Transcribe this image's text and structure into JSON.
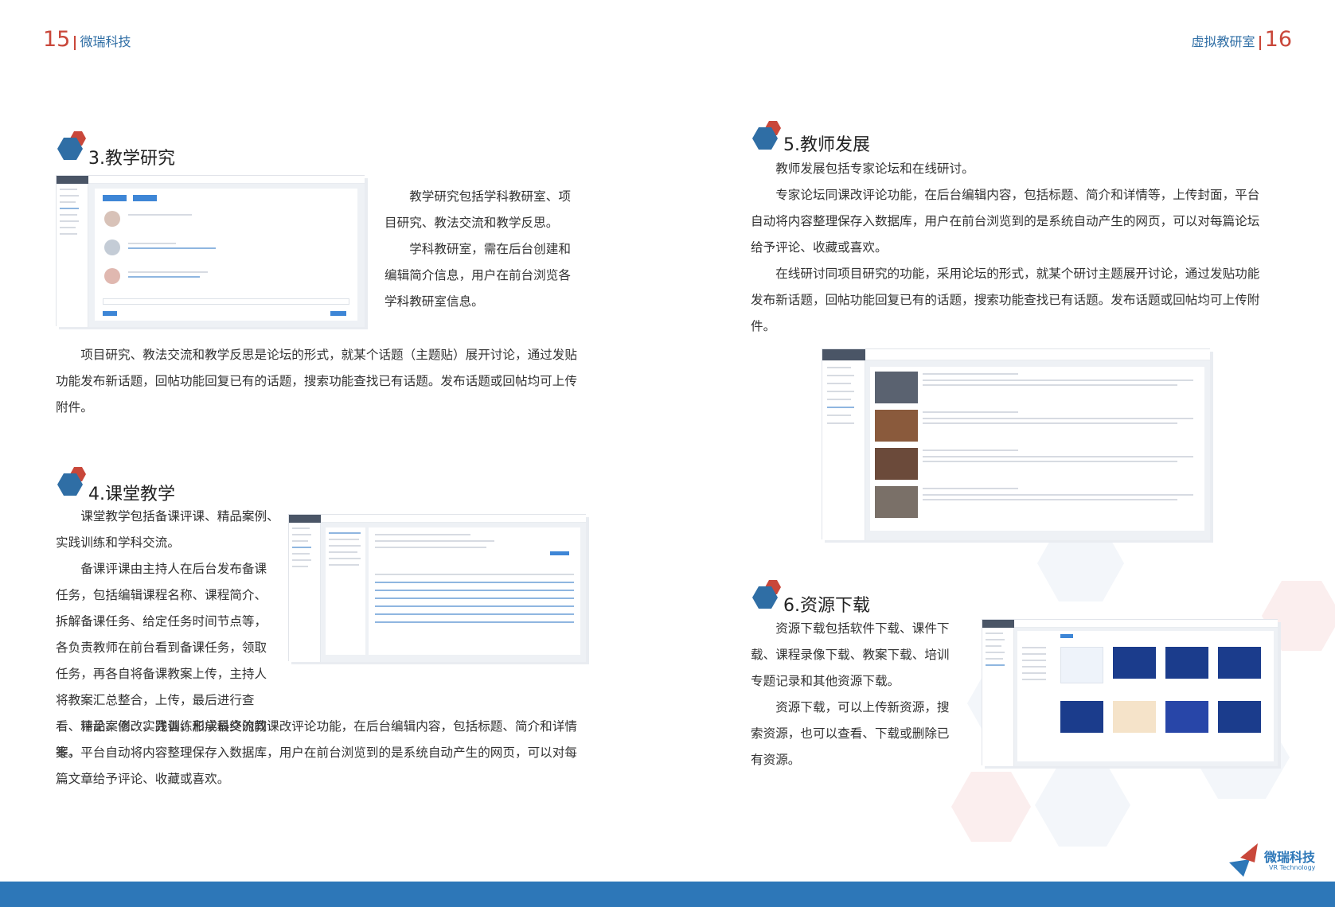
{
  "header": {
    "left_page_number": "15",
    "left_brand": "微瑞科技",
    "right_title": "虚拟教研室",
    "right_page_number": "16"
  },
  "section3": {
    "title": "3.教学研究",
    "para1": "教学研究包括学科教研室、项目研究、教法交流和教学反思。",
    "para2": "学科教研室，需在后台创建和编辑简介信息，用户在前台浏览各学科教研室信息。",
    "para3": "项目研究、教法交流和教学反思是论坛的形式，就某个话题（主题贴）展开讨论，通过发贴功能发布新话题，回帖功能回复已有的话题，搜索功能查找已有话题。发布话题或回帖均可上传附件。"
  },
  "section4": {
    "title": "4.课堂教学",
    "para1": "课堂教学包括备课评课、精品案例、实践训练和学科交流。",
    "para2": "备课评课由主持人在后台发布备课任务，包括编辑课程名称、课程简介、拆解备课任务、给定任务时间节点等，各负责教师在前台看到备课任务，领取任务，再各自将备课教案上传，主持人将教案汇总整合，上传，最后进行查看、评论、修改、完善，形成最终的教案。",
    "para3": "精品案例、实践训练和学科交流同课改评论功能，在后台编辑内容，包括标题、简介和详情等，平台自动将内容整理保存入数据库，用户在前台浏览到的是系统自动产生的网页，可以对每篇文章给予评论、收藏或喜欢。"
  },
  "section5": {
    "title": "5.教师发展",
    "para1": "教师发展包括专家论坛和在线研讨。",
    "para2": "专家论坛同课改评论功能，在后台编辑内容，包括标题、简介和详情等，上传封面，平台自动将内容整理保存入数据库，用户在前台浏览到的是系统自动产生的网页，可以对每篇论坛给予评论、收藏或喜欢。",
    "para3": "在线研讨同项目研究的功能，采用论坛的形式，就某个研讨主题展开讨论，通过发贴功能发布新话题，回帖功能回复已有的话题，搜索功能查找已有话题。发布话题或回帖均可上传附件。"
  },
  "section6": {
    "title": "6.资源下载",
    "para1": "资源下载包括软件下载、课件下载、课程录像下载、教案下载、培训专题记录和其他资源下载。",
    "para2": "资源下载，可以上传新资源，搜索资源，也可以查看、下载或删除已有资源。"
  },
  "footer_logo": {
    "name": "微瑞科技",
    "sub": "VR Technology"
  },
  "colors": {
    "accent_red": "#c9473a",
    "accent_blue": "#2f6ea5",
    "footer_blue": "#2d77b8"
  }
}
